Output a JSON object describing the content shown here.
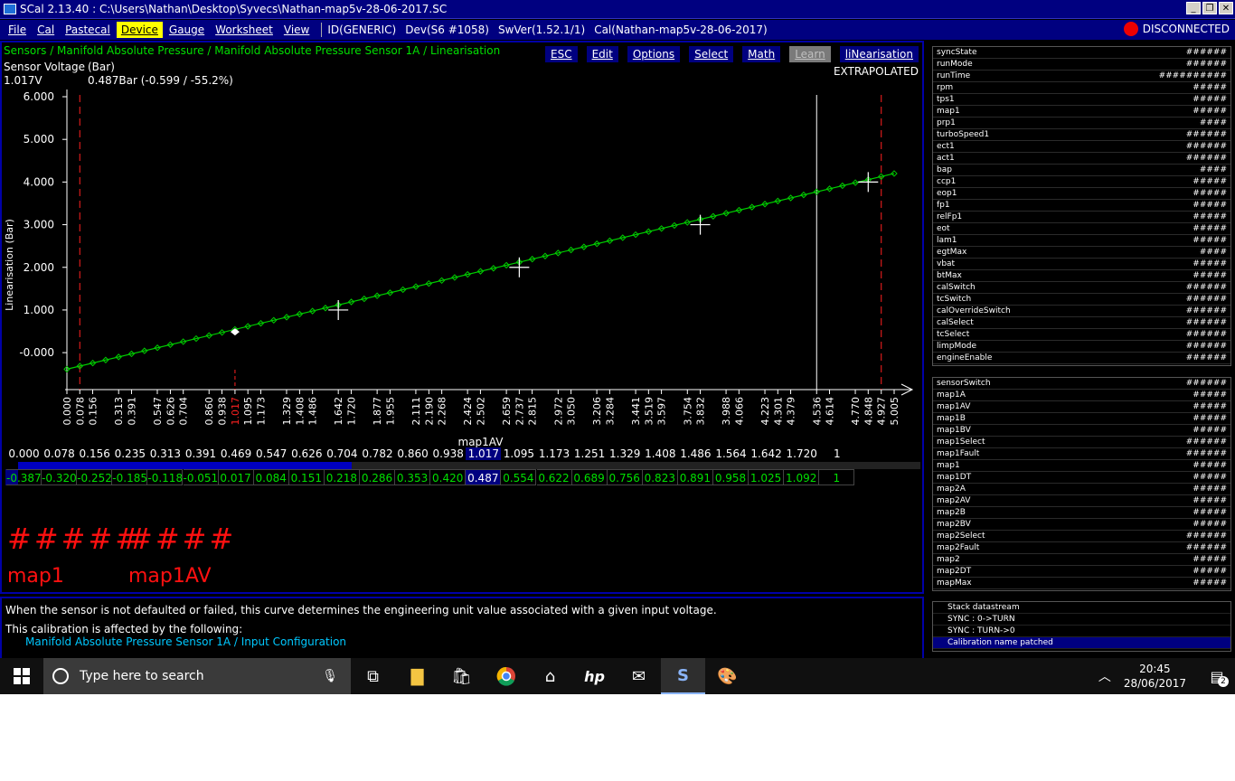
{
  "window": {
    "title": "SCal 2.13.40  :  C:\\Users\\Nathan\\Desktop\\Syvecs\\Nathan-map5v-28-06-2017.SC",
    "controls": [
      "_",
      "❐",
      "✕"
    ]
  },
  "menu": {
    "items": [
      "File",
      "Cal",
      "Pastecal",
      "Device",
      "Gauge",
      "Worksheet",
      "View"
    ],
    "active": "Device",
    "info": [
      "ID(GENERIC)",
      "Dev(S6 #1058)",
      "SwVer(1.52.1/1)",
      "Cal(Nathan-map5v-28-06-2017)"
    ],
    "status": "DISCONNECTED",
    "status_color": "#e00000"
  },
  "main": {
    "breadcrumb": "Sensors / Manifold Absolute Pressure / Manifold Absolute Pressure Sensor 1A / Linearisation",
    "buttons": [
      "ESC",
      "Edit",
      "Options",
      "Select",
      "Math",
      "Learn",
      "liNearisation"
    ],
    "disabled_button": "Learn",
    "extrapolated": "EXTRAPOLATED",
    "sensor_label": "Sensor Voltage",
    "unit_label": "(Bar)",
    "voltage": "1.017V",
    "readout": "0.487Bar (-0.599 / -55.2%)"
  },
  "chart_data": {
    "type": "line",
    "xlabel": "map1AV",
    "ylabel": "Linearisation (Bar)",
    "xlim": [
      0.0,
      5.005
    ],
    "ylim": [
      -0.4,
      6.0
    ],
    "y_ticks": [
      "6.000",
      "5.000",
      "4.000",
      "3.000",
      "2.000",
      "1.000",
      "-0.000"
    ],
    "y_tick_values": [
      6,
      5,
      4,
      3,
      2,
      1,
      0
    ],
    "x_ticks": [
      "0.000",
      "0.078",
      "0.156",
      "0.313",
      "0.391",
      "0.547",
      "0.626",
      "0.704",
      "0.860",
      "0.938",
      "1.017",
      "1.095",
      "1.173",
      "1.329",
      "1.408",
      "1.486",
      "1.642",
      "1.720",
      "1.877",
      "1.955",
      "2.111",
      "2.190",
      "2.268",
      "2.424",
      "2.502",
      "2.659",
      "2.737",
      "2.815",
      "2.972",
      "3.050",
      "3.206",
      "3.284",
      "3.441",
      "3.519",
      "3.597",
      "3.754",
      "3.832",
      "3.988",
      "4.066",
      "4.223",
      "4.301",
      "4.379",
      "4.536",
      "4.614",
      "4.770",
      "4.848",
      "4.927",
      "5.005"
    ],
    "highlight_x_tick": "1.017",
    "line_start": [
      0.0,
      -0.387
    ],
    "line_end": [
      5.005,
      4.2
    ],
    "marker_count": 65,
    "cross_points": [
      [
        1.642,
        1.0
      ],
      [
        2.737,
        2.0
      ],
      [
        3.832,
        3.0
      ],
      [
        4.848,
        4.0
      ]
    ],
    "current_point": [
      1.017,
      0.487
    ],
    "red_dashed_x": [
      0.078,
      4.927
    ],
    "white_line_x": 4.536,
    "grid": false,
    "line_color": "#00cc00",
    "highlight_color": "#ff2020"
  },
  "table": {
    "x": [
      "0.000",
      "0.078",
      "0.156",
      "0.235",
      "0.313",
      "0.391",
      "0.469",
      "0.547",
      "0.626",
      "0.704",
      "0.782",
      "0.860",
      "0.938",
      "1.017",
      "1.095",
      "1.173",
      "1.251",
      "1.329",
      "1.408",
      "1.486",
      "1.564",
      "1.642",
      "1.720",
      "1"
    ],
    "y": [
      "-0.387",
      "-0.320",
      "-0.252",
      "-0.185",
      "-0.118",
      "-0.051",
      "0.017",
      "0.084",
      "0.151",
      "0.218",
      "0.286",
      "0.353",
      "0.420",
      "0.487",
      "0.554",
      "0.622",
      "0.689",
      "0.756",
      "0.823",
      "0.891",
      "0.958",
      "1.025",
      "1.092",
      "1"
    ],
    "selected_index": 13,
    "scroll_fraction": 0.37
  },
  "big": {
    "val1": "#####",
    "val2": "####",
    "lbl1": "map1",
    "lbl2": "map1AV"
  },
  "description": {
    "text": "When the sensor is not defaulted or failed, this curve determines the engineering unit value associated with a given input voltage.",
    "affected": "This calibration is affected by the following:",
    "link": "Manifold Absolute Pressure Sensor 1A / Input Configuration"
  },
  "side1": [
    [
      "syncState",
      "######"
    ],
    [
      "runMode",
      "######"
    ],
    [
      "runTime",
      "##########"
    ],
    [
      "rpm",
      "#####"
    ],
    [
      "tps1",
      "#####"
    ],
    [
      "map1",
      "#####"
    ],
    [
      "prp1",
      "####"
    ],
    [
      "turboSpeed1",
      "######"
    ],
    [
      "ect1",
      "######"
    ],
    [
      "act1",
      "######"
    ],
    [
      "bap",
      "####"
    ],
    [
      "ccp1",
      "#####"
    ],
    [
      "eop1",
      "#####"
    ],
    [
      "fp1",
      "#####"
    ],
    [
      "relFp1",
      "#####"
    ],
    [
      "eot",
      "#####"
    ],
    [
      "lam1",
      "#####"
    ],
    [
      "egtMax",
      "####"
    ],
    [
      "vbat",
      "#####"
    ],
    [
      "btMax",
      "#####"
    ],
    [
      "calSwitch",
      "######"
    ],
    [
      "tcSwitch",
      "######"
    ],
    [
      "calOverrideSwitch",
      "######"
    ],
    [
      "calSelect",
      "######"
    ],
    [
      "tcSelect",
      "######"
    ],
    [
      "limpMode",
      "######"
    ],
    [
      "engineEnable",
      "######"
    ]
  ],
  "side2": [
    [
      "sensorSwitch",
      "######"
    ],
    [
      "map1A",
      "#####"
    ],
    [
      "map1AV",
      "#####"
    ],
    [
      "map1B",
      "#####"
    ],
    [
      "map1BV",
      "#####"
    ],
    [
      "map1Select",
      "######"
    ],
    [
      "map1Fault",
      "######"
    ],
    [
      "map1",
      "#####"
    ],
    [
      "map1DT",
      "#####"
    ],
    [
      "map2A",
      "#####"
    ],
    [
      "map2AV",
      "#####"
    ],
    [
      "map2B",
      "#####"
    ],
    [
      "map2BV",
      "#####"
    ],
    [
      "map2Select",
      "######"
    ],
    [
      "map2Fault",
      "######"
    ],
    [
      "map2",
      "#####"
    ],
    [
      "map2DT",
      "#####"
    ],
    [
      "mapMax",
      "#####"
    ]
  ],
  "messages": [
    "Stack datastream",
    "SYNC : 0->TURN",
    "SYNC : TURN->0",
    "Calibration name patched"
  ],
  "highlight_message": "Calibration name patched",
  "taskbar": {
    "search_placeholder": "Type here to search",
    "time": "20:45",
    "date": "28/06/2017",
    "notifications": "2",
    "icons": [
      "task-view-icon",
      "file-explorer-icon",
      "store-icon",
      "chrome-icon",
      "home-icon",
      "hp-icon",
      "mail-icon",
      "scal-icon",
      "paint-icon"
    ]
  }
}
